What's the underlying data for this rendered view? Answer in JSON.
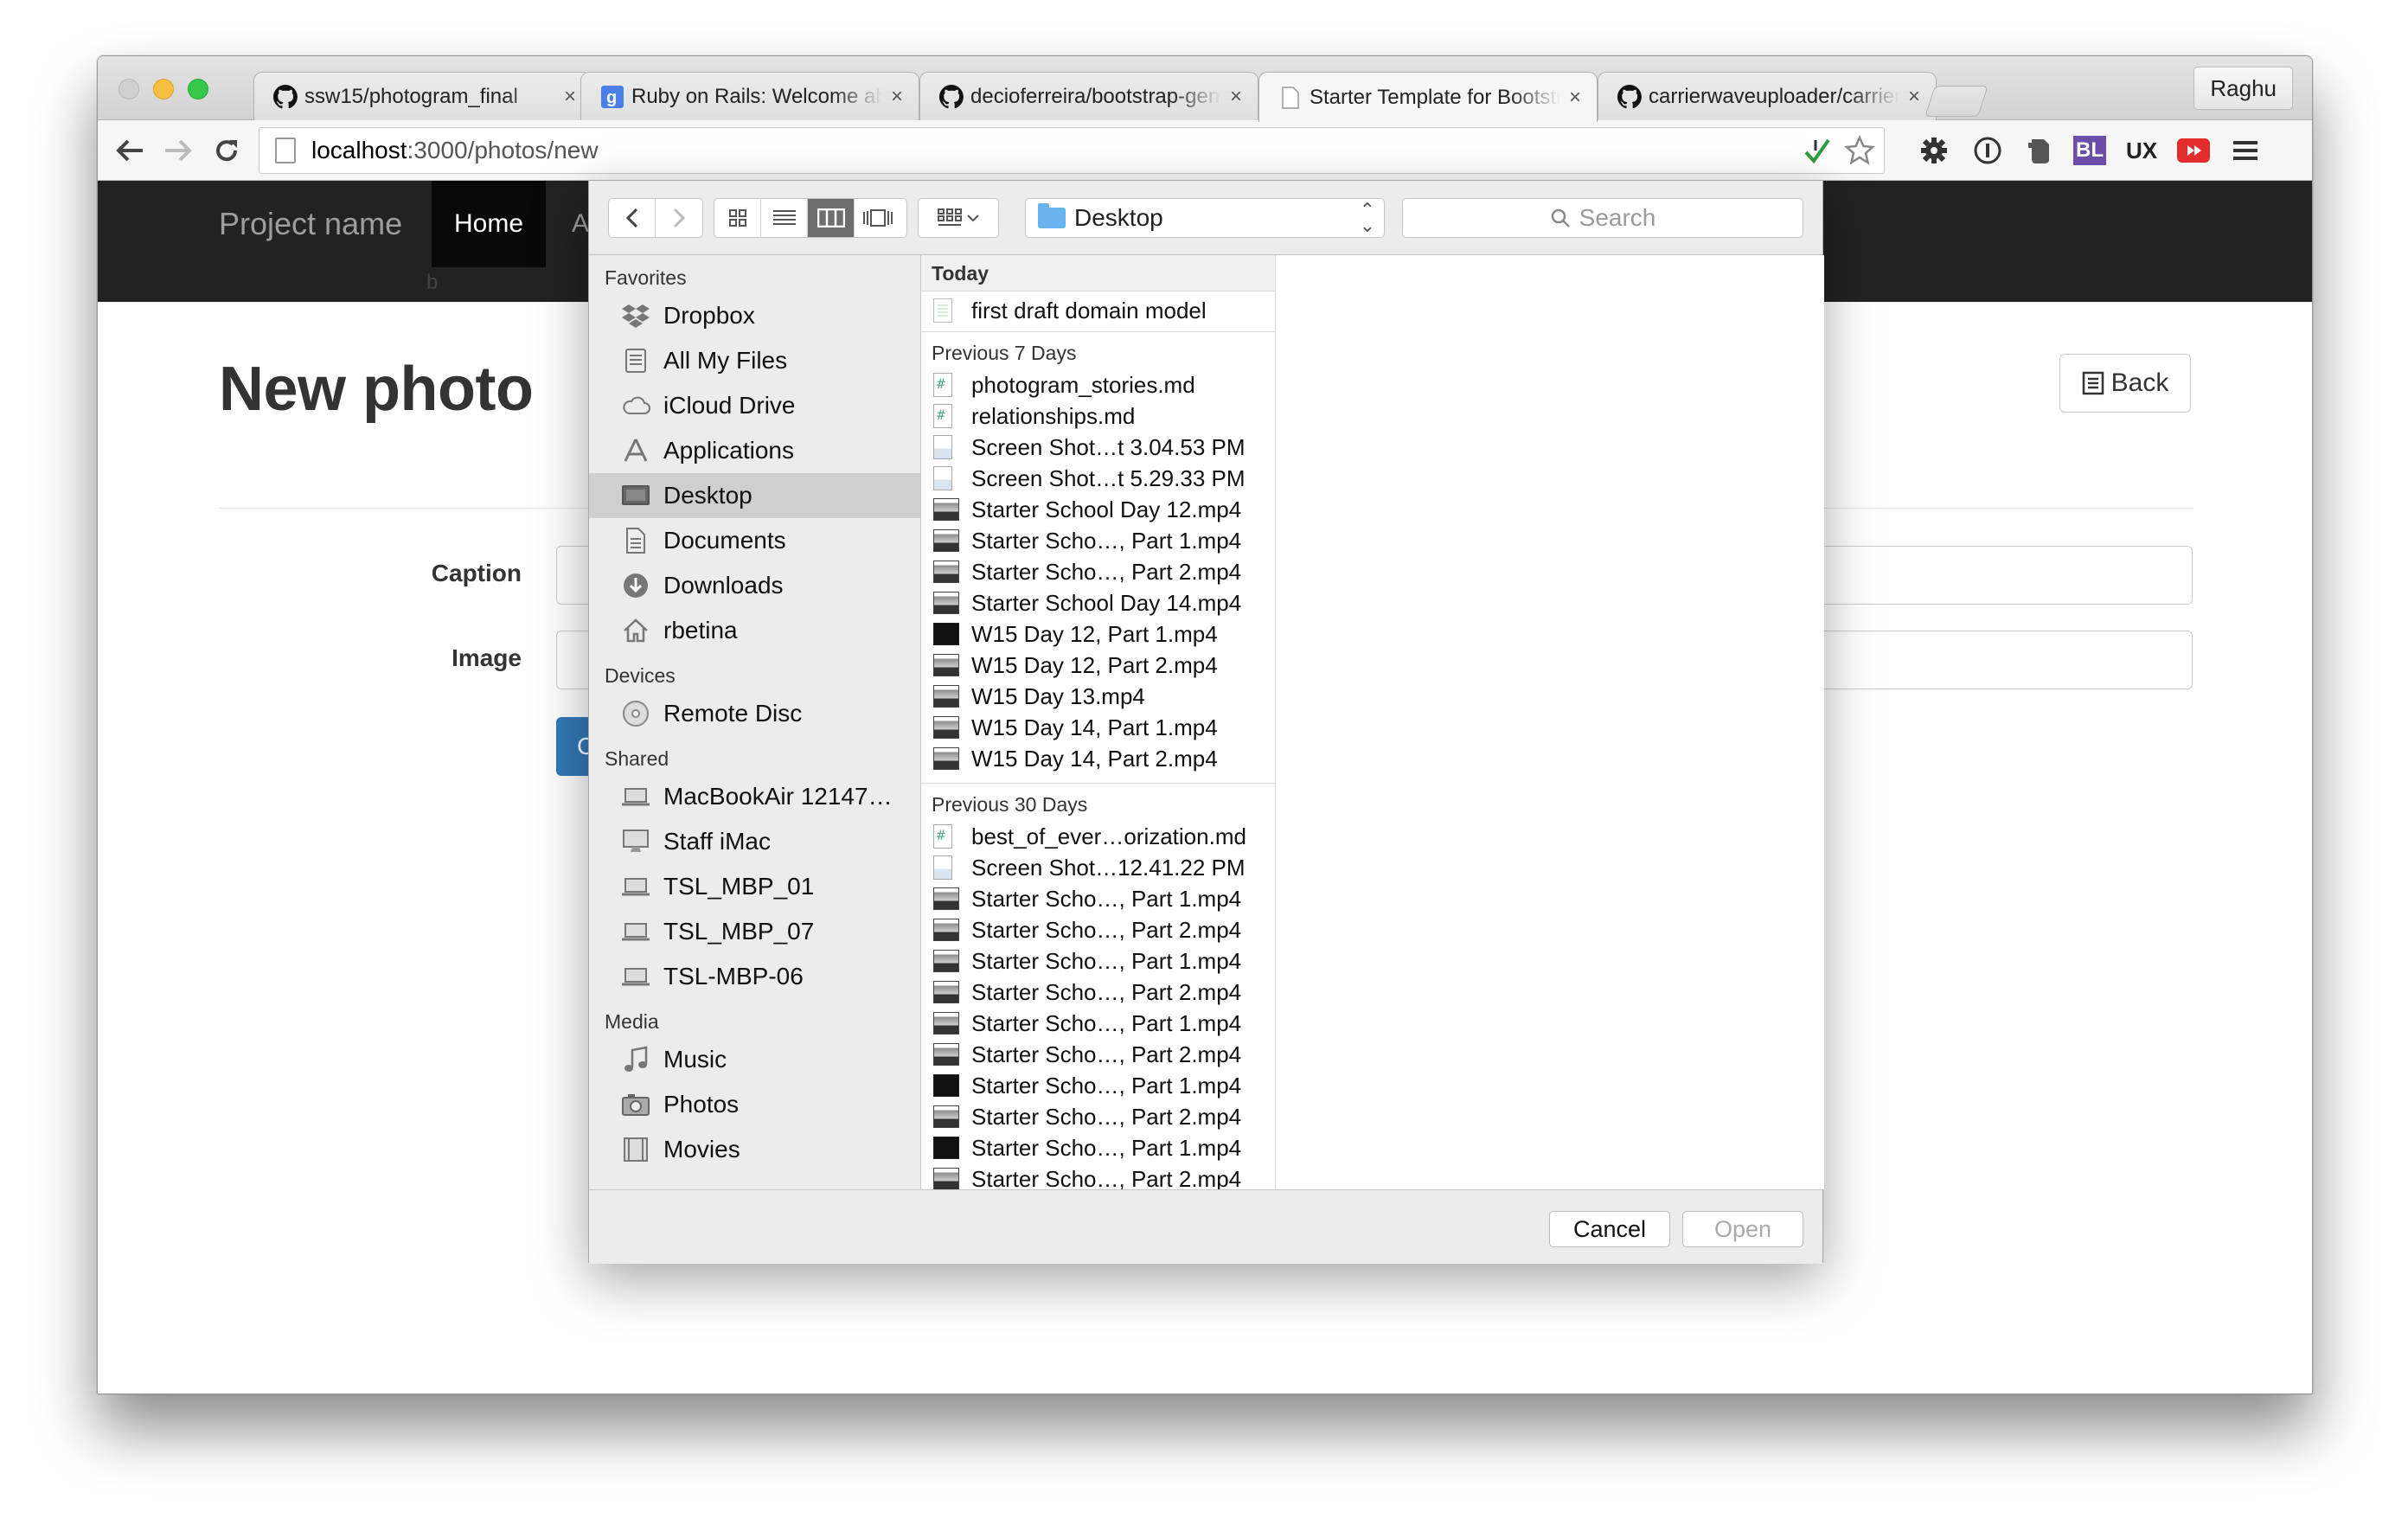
{
  "browser": {
    "tabs": [
      {
        "title": "ssw15/photogram_final",
        "icon": "github-icon"
      },
      {
        "title": "Ruby on Rails: Welcome aboard",
        "icon": "google-icon"
      },
      {
        "title": "decioferreira/bootstrap-generators",
        "icon": "github-icon"
      },
      {
        "title": "Starter Template for Bootstrap",
        "icon": "page-icon"
      },
      {
        "title": "carrierwaveuploader/carrierwave",
        "icon": "github-icon"
      }
    ],
    "tab_close": "×",
    "profile": "Raghu",
    "url_host": "localhost",
    "url_path": ":3000/photos/new",
    "extensions": {
      "bl": "BL",
      "ux": "UX"
    }
  },
  "app": {
    "brand": "Project name",
    "nav_home": "Home",
    "nav_next": "A",
    "nav_ghost": "b",
    "page_title": "New photo",
    "back_label": "Back",
    "caption_label": "Caption",
    "image_label": "Image",
    "submit_partial": "C",
    "colors": {
      "navbar": "#222222",
      "primary": "#337ab7"
    }
  },
  "dialog": {
    "location": "Desktop",
    "search_placeholder": "Search",
    "sidebar": {
      "favorites_head": "Favorites",
      "favorites": [
        {
          "label": "Dropbox",
          "icon": "dropbox-icon"
        },
        {
          "label": "All My Files",
          "icon": "all-files-icon"
        },
        {
          "label": "iCloud Drive",
          "icon": "cloud-icon"
        },
        {
          "label": "Applications",
          "icon": "applications-icon"
        },
        {
          "label": "Desktop",
          "icon": "desktop-icon"
        },
        {
          "label": "Documents",
          "icon": "documents-icon"
        },
        {
          "label": "Downloads",
          "icon": "downloads-icon"
        },
        {
          "label": "rbetina",
          "icon": "home-icon"
        }
      ],
      "devices_head": "Devices",
      "devices": [
        {
          "label": "Remote Disc",
          "icon": "disc-icon"
        }
      ],
      "shared_head": "Shared",
      "shared": [
        {
          "label": "MacBookAir 12147…",
          "icon": "laptop-icon"
        },
        {
          "label": "Staff iMac",
          "icon": "imac-icon"
        },
        {
          "label": "TSL_MBP_01",
          "icon": "laptop-icon"
        },
        {
          "label": "TSL_MBP_07",
          "icon": "laptop-icon"
        },
        {
          "label": "TSL-MBP-06",
          "icon": "laptop-icon"
        }
      ],
      "media_head": "Media",
      "media": [
        {
          "label": "Music",
          "icon": "music-icon"
        },
        {
          "label": "Photos",
          "icon": "camera-icon"
        },
        {
          "label": "Movies",
          "icon": "film-icon"
        }
      ]
    },
    "today_head": "Today",
    "today_files": [
      {
        "name": "first draft domain model",
        "kind": "doc"
      }
    ],
    "week_head": "Previous 7 Days",
    "week_files": [
      {
        "name": "photogram_stories.md",
        "kind": "md"
      },
      {
        "name": "relationships.md",
        "kind": "md"
      },
      {
        "name": "Screen Shot…t 3.04.53 PM",
        "kind": "img"
      },
      {
        "name": "Screen Shot…t 5.29.33 PM",
        "kind": "img"
      },
      {
        "name": "Starter School Day 12.mp4",
        "kind": "vid"
      },
      {
        "name": "Starter Scho…, Part 1.mp4",
        "kind": "vid"
      },
      {
        "name": "Starter Scho…, Part 2.mp4",
        "kind": "vid"
      },
      {
        "name": "Starter School Day 14.mp4",
        "kind": "vid"
      },
      {
        "name": "W15 Day 12, Part 1.mp4",
        "kind": "viddark"
      },
      {
        "name": "W15 Day 12, Part 2.mp4",
        "kind": "vid"
      },
      {
        "name": "W15 Day 13.mp4",
        "kind": "vid"
      },
      {
        "name": "W15 Day 14, Part 1.mp4",
        "kind": "vid"
      },
      {
        "name": "W15 Day 14, Part 2.mp4",
        "kind": "vid"
      }
    ],
    "month_head": "Previous 30 Days",
    "month_files": [
      {
        "name": "best_of_ever…orization.md",
        "kind": "md"
      },
      {
        "name": "Screen Shot…12.41.22 PM",
        "kind": "img"
      },
      {
        "name": "Starter Scho…, Part 1.mp4",
        "kind": "vid"
      },
      {
        "name": "Starter Scho…, Part 2.mp4",
        "kind": "vid"
      },
      {
        "name": "Starter Scho…, Part 1.mp4",
        "kind": "vid"
      },
      {
        "name": "Starter Scho…, Part 2.mp4",
        "kind": "vid"
      },
      {
        "name": "Starter Scho…, Part 1.mp4",
        "kind": "vid"
      },
      {
        "name": "Starter Scho…, Part 2.mp4",
        "kind": "vid"
      },
      {
        "name": "Starter Scho…, Part 1.mp4",
        "kind": "viddark"
      },
      {
        "name": "Starter Scho…, Part 2.mp4",
        "kind": "vid"
      },
      {
        "name": "Starter Scho…, Part 1.mp4",
        "kind": "viddark"
      },
      {
        "name": "Starter Scho…, Part 2.mp4",
        "kind": "vid"
      }
    ],
    "cancel_label": "Cancel",
    "open_label": "Open"
  }
}
